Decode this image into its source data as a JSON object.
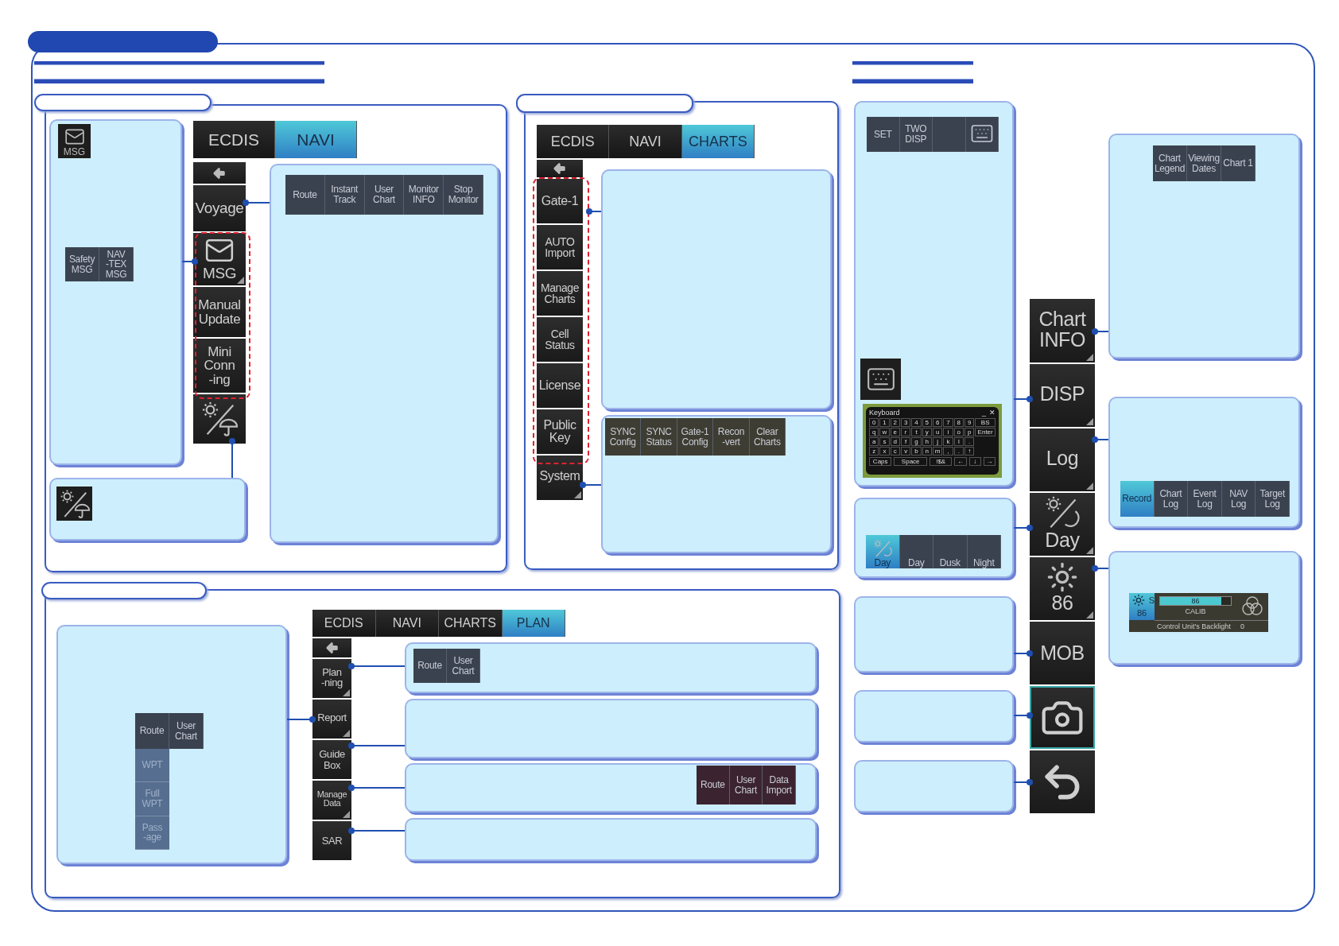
{
  "navi_panel": {
    "tabs": [
      {
        "label": "ECDIS",
        "selected": false
      },
      {
        "label": "NAVI",
        "selected": true
      }
    ],
    "menu": [
      {
        "kind": "back",
        "corner": false
      },
      {
        "kind": "text",
        "label": "Voyage",
        "corner": false
      },
      {
        "kind": "msg",
        "label": "MSG",
        "corner": true
      },
      {
        "kind": "text",
        "label": "Manual\nUpdate",
        "corner": false
      },
      {
        "kind": "text",
        "label": "Mini\nConn\n-ing",
        "corner": false
      },
      {
        "kind": "brightness",
        "corner": false
      }
    ],
    "msg_callout": {
      "icon_label": "MSG",
      "buttons": [
        {
          "label": "Safety\nMSG"
        },
        {
          "label": "NAV\n-TEX\nMSG"
        }
      ]
    },
    "voyage_callout": {
      "buttons": [
        {
          "label": "Route"
        },
        {
          "label": "Instant\nTrack"
        },
        {
          "label": "User\nChart"
        },
        {
          "label": "Monitor\nINFO"
        },
        {
          "label": "Stop\nMonitor"
        }
      ]
    }
  },
  "charts_panel": {
    "tabs": [
      {
        "label": "ECDIS",
        "selected": false
      },
      {
        "label": "NAVI",
        "selected": false
      },
      {
        "label": "CHARTS",
        "selected": true
      }
    ],
    "menu": [
      {
        "kind": "back",
        "corner": false
      },
      {
        "kind": "text",
        "label": "Gate-1",
        "corner": false
      },
      {
        "kind": "text",
        "label": "AUTO\nImport",
        "corner": false
      },
      {
        "kind": "text",
        "label": "Manage\nCharts",
        "corner": false
      },
      {
        "kind": "text",
        "label": "Cell\nStatus",
        "corner": false
      },
      {
        "kind": "text",
        "label": "License",
        "corner": false
      },
      {
        "kind": "text",
        "label": "Public\nKey",
        "corner": false
      },
      {
        "kind": "text",
        "label": "System",
        "corner": true
      }
    ],
    "system_callout": {
      "buttons": [
        {
          "label": "SYNC\nConfig"
        },
        {
          "label": "SYNC\nStatus"
        },
        {
          "label": "Gate-1\nConfig"
        },
        {
          "label": "Recon\n-vert"
        },
        {
          "label": "Clear\nCharts"
        }
      ]
    }
  },
  "plan_panel": {
    "tabs": [
      {
        "label": "ECDIS",
        "selected": false
      },
      {
        "label": "NAVI",
        "selected": false
      },
      {
        "label": "CHARTS",
        "selected": false
      },
      {
        "label": "PLAN",
        "selected": true
      }
    ],
    "menu": [
      {
        "kind": "back",
        "corner": false
      },
      {
        "kind": "text",
        "label": "Plan\n-ning",
        "corner": true
      },
      {
        "kind": "text",
        "label": "Report",
        "corner": true
      },
      {
        "kind": "text",
        "label": "Guide\nBox",
        "corner": false
      },
      {
        "kind": "text",
        "label": "Manage\nData",
        "corner": true
      },
      {
        "kind": "text",
        "label": "SAR",
        "corner": false
      }
    ],
    "report_callout": {
      "buttons": [
        {
          "label": "Route",
          "disabled": false
        },
        {
          "label": "User\nChart",
          "disabled": false
        }
      ],
      "sub_buttons": [
        {
          "label": "WPT",
          "disabled": true
        },
        {
          "label": "Full\nWPT",
          "disabled": true
        },
        {
          "label": "Pass\n-age",
          "disabled": true
        }
      ]
    },
    "planning_callout": {
      "buttons": [
        {
          "label": "Route"
        },
        {
          "label": "User\nChart"
        }
      ]
    },
    "manage_callout": {
      "buttons": [
        {
          "label": "Route"
        },
        {
          "label": "User\nChart"
        },
        {
          "label": "Data\nImport"
        }
      ]
    }
  },
  "status_bar": {
    "items": [
      {
        "kind": "text",
        "label": "Chart\nINFO",
        "corner": true,
        "selected": false
      },
      {
        "kind": "text",
        "label": "DISP",
        "corner": true,
        "selected": false
      },
      {
        "kind": "text",
        "label": "Log",
        "corner": true,
        "selected": false
      },
      {
        "kind": "daynight",
        "label": "Day",
        "corner": true,
        "selected": false
      },
      {
        "kind": "brightness",
        "label": "86",
        "corner": true,
        "selected": false
      },
      {
        "kind": "text",
        "label": "MOB",
        "corner": false,
        "selected": false
      },
      {
        "kind": "camera",
        "corner": false,
        "selected": true
      },
      {
        "kind": "undo",
        "corner": false,
        "selected": false
      }
    ]
  },
  "disp_callout": {
    "buttons": [
      {
        "kind": "text",
        "label": "SET"
      },
      {
        "kind": "text",
        "label": "TWO\nDISP"
      },
      {
        "kind": "blank"
      },
      {
        "kind": "keyboard"
      }
    ],
    "keyboard": {
      "title": "Keyboard",
      "window_buttons": [
        "_",
        "✕"
      ],
      "rows": [
        [
          "0",
          "1",
          "2",
          "3",
          "4",
          "5",
          "6",
          "7",
          "8",
          "9",
          "BS"
        ],
        [
          "q",
          "w",
          "e",
          "r",
          "t",
          "y",
          "u",
          "i",
          "o",
          "p",
          "Enter"
        ],
        [
          "a",
          "s",
          "d",
          "f",
          "g",
          "h",
          "j",
          "k",
          "l",
          "."
        ],
        [
          "z",
          "x",
          "c",
          "v",
          "b",
          "n",
          "m",
          ",",
          ".",
          "↑"
        ]
      ],
      "function_keys": [
        "Caps",
        "Space",
        "!$&",
        "←",
        "↓",
        "→"
      ]
    }
  },
  "daynight_callout": {
    "buttons": [
      {
        "kind": "icon",
        "label": "Day",
        "selected": true
      },
      {
        "kind": "text",
        "label": "Day",
        "selected": false
      },
      {
        "kind": "text",
        "label": "Dusk",
        "selected": false
      },
      {
        "kind": "text",
        "label": "Night",
        "selected": false
      }
    ]
  },
  "chartinfo_callout": {
    "buttons": [
      {
        "label": "Chart\nLegend"
      },
      {
        "label": "Viewing\nDates"
      },
      {
        "label": "Chart 1"
      }
    ]
  },
  "log_callout": {
    "buttons": [
      {
        "label": "Record",
        "selected": true
      },
      {
        "label": "Chart\nLog",
        "selected": false
      },
      {
        "label": "Event\nLog",
        "selected": false
      },
      {
        "label": "NAV\nLog",
        "selected": false
      },
      {
        "label": "Target\nLog",
        "selected": false
      }
    ]
  },
  "brightness_callout": {
    "mode": "S",
    "value": "86",
    "bar_reading": "86",
    "level": 0.86,
    "calib": "CALIB",
    "backlight_label": "Control Unit's Backlight",
    "backlight_value": "0"
  }
}
